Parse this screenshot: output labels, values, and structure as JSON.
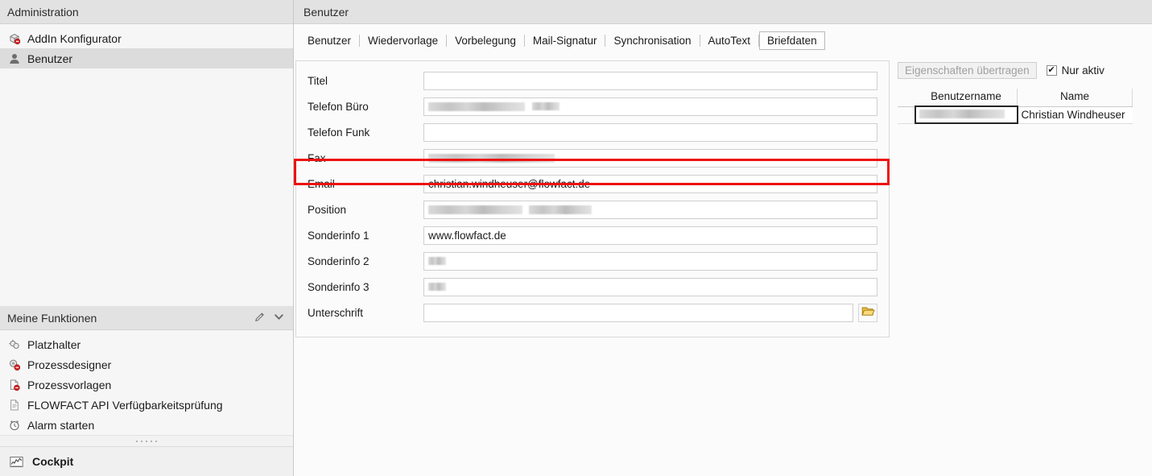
{
  "sidebar": {
    "section_admin": {
      "title": "Administration",
      "items": [
        {
          "label": "AddIn Konfigurator",
          "icon": "box-addin-icon",
          "selected": false
        },
        {
          "label": "Benutzer",
          "icon": "user-icon",
          "selected": true
        }
      ]
    },
    "section_functions": {
      "title": "Meine Funktionen",
      "edit_icon": "pencil-icon",
      "collapse_icon": "chevron-down-icon",
      "items": [
        {
          "label": "Platzhalter",
          "icon": "placeholder-icon"
        },
        {
          "label": "Prozessdesigner",
          "icon": "process-designer-icon"
        },
        {
          "label": "Prozessvorlagen",
          "icon": "process-template-icon"
        },
        {
          "label": "FLOWFACT API Verfügbarkeitsprüfung",
          "icon": "document-icon"
        },
        {
          "label": "Alarm starten",
          "icon": "alarm-clock-icon"
        }
      ]
    },
    "footer": {
      "grip_icon": "drag-handle-icon",
      "cockpit_label": "Cockpit",
      "cockpit_icon": "chart-icon"
    }
  },
  "main": {
    "header_title": "Benutzer",
    "tabs": [
      {
        "label": "Benutzer",
        "active": false
      },
      {
        "label": "Wiedervorlage",
        "active": false
      },
      {
        "label": "Vorbelegung",
        "active": false
      },
      {
        "label": "Mail-Signatur",
        "active": false
      },
      {
        "label": "Synchronisation",
        "active": false
      },
      {
        "label": "AutoText",
        "active": false
      },
      {
        "label": "Briefdaten",
        "active": true
      }
    ],
    "form": {
      "fields": [
        {
          "label": "Titel",
          "value": "",
          "redacted": false,
          "redact_width": 0
        },
        {
          "label": "Telefon Büro",
          "value": "",
          "redacted": true,
          "redact_width": 155
        },
        {
          "label": "Telefon Funk",
          "value": "",
          "redacted": false,
          "redact_width": 0
        },
        {
          "label": "Fax",
          "value": "",
          "redacted": true,
          "redact_width": 157
        },
        {
          "label": "Email",
          "value": "christian.windheuser@flowfact.de",
          "redacted": false,
          "redact_width": 0
        },
        {
          "label": "Position",
          "value": "",
          "redacted": true,
          "redact_width": 203
        },
        {
          "label": "Sonderinfo 1",
          "value": "www.flowfact.de",
          "redacted": false,
          "redact_width": 0
        },
        {
          "label": "Sonderinfo 2",
          "value": "",
          "redacted": true,
          "redact_width": 22
        },
        {
          "label": "Sonderinfo 3",
          "value": "",
          "redacted": true,
          "redact_width": 22
        },
        {
          "label": "Unterschrift",
          "value": "",
          "redacted": false,
          "redact_width": 0,
          "browse_icon": "open-folder-icon"
        }
      ],
      "highlighted_field": "Email"
    },
    "right_panel": {
      "transfer_button": "Eigenschaften übertragen",
      "transfer_button_enabled": false,
      "only_active_label": "Nur aktiv",
      "only_active_checked": true,
      "check_glyph": "✔",
      "grid": {
        "columns": [
          "Benutzername",
          "Name"
        ],
        "rows": [
          {
            "username": "",
            "username_redacted": true,
            "name": "Christian Windheuser",
            "selected": true
          }
        ]
      }
    }
  },
  "colors": {
    "highlight": "#ee1111",
    "header_bar": "#e2e2e2",
    "selection": "#dcdcdc",
    "folder_icon": "#e8b339"
  }
}
